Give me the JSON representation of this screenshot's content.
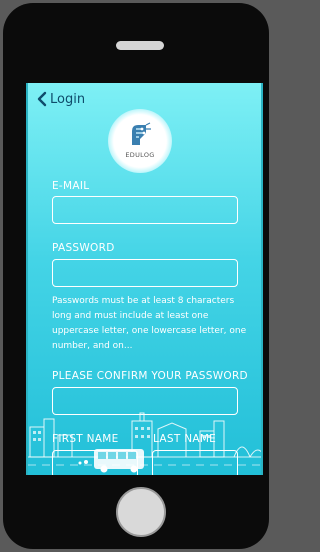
{
  "nav": {
    "back_label": "Login"
  },
  "logo": {
    "text": "EDULOG"
  },
  "form": {
    "email_label": "E-MAIL",
    "email_value": "",
    "password_label": "PASSWORD",
    "password_value": "",
    "password_hint": "Passwords must be at least 8 characters long and must include at least one uppercase letter, one lowercase letter, one number, and on...",
    "confirm_label": "PLEASE CONFIRM YOUR PASSWORD",
    "confirm_value": "",
    "first_name_label": "FIRST NAME",
    "first_name_value": "",
    "last_name_label": "LAST NAME",
    "last_name_value": ""
  },
  "colors": {
    "accent": "#0f4c6b",
    "screen_top": "#7ef0f5",
    "screen_bottom": "#22bfd8"
  }
}
